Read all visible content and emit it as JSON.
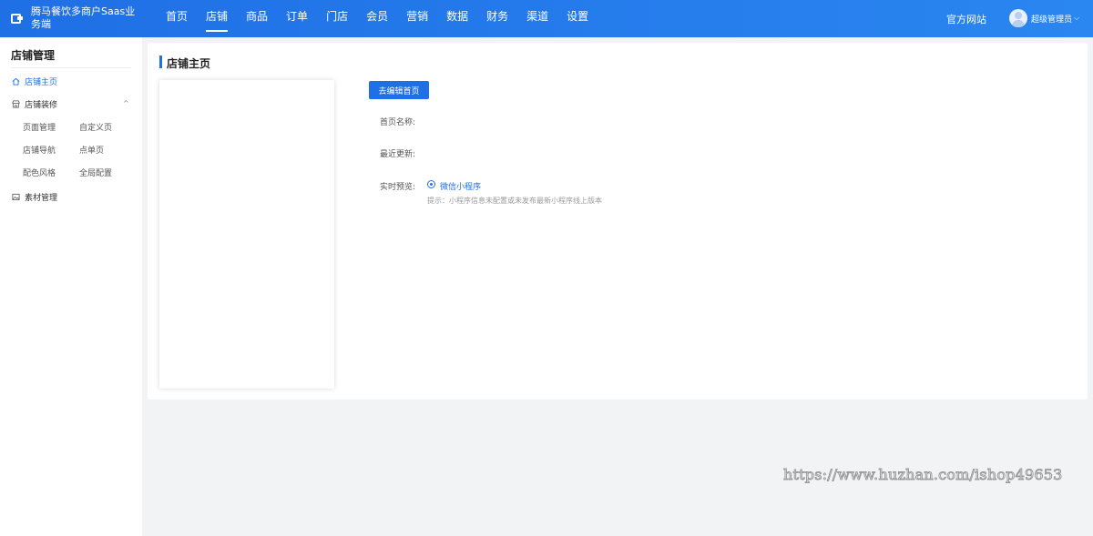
{
  "header": {
    "brand_name": "腾马餐饮多商户Saas业务端",
    "nav": [
      {
        "label": "首页"
      },
      {
        "label": "店铺",
        "active": true
      },
      {
        "label": "商品"
      },
      {
        "label": "订单"
      },
      {
        "label": "门店"
      },
      {
        "label": "会员"
      },
      {
        "label": "营销"
      },
      {
        "label": "数据"
      },
      {
        "label": "财务"
      },
      {
        "label": "渠道"
      },
      {
        "label": "设置"
      }
    ],
    "official_site": "官方网站",
    "user_name": "超级管理员",
    "user_caret": "⌵"
  },
  "sidebar": {
    "title": "店铺管理",
    "home": "店铺主页",
    "decoration": "店铺装修",
    "decoration_items": [
      "页面管理",
      "自定义页",
      "店铺导航",
      "点单页",
      "配色风格",
      "全局配置"
    ],
    "materials": "素材管理",
    "collapse_caret": "^"
  },
  "main": {
    "title": "店铺主页",
    "edit_button": "去编辑首页",
    "home_name_label": "首页名称:",
    "last_updated_label": "最近更新:",
    "preview_label": "实时预览:",
    "preview_option": "微信小程序",
    "hint": "提示：小程序信息未配置或未发布最新小程序线上版本"
  },
  "watermark": "https://www.huzhan.com/ishop49653",
  "colors": {
    "primary": "#1f6fe5",
    "header_gradient_end": "#2a86f0",
    "page_bg": "#f2f3f5"
  }
}
